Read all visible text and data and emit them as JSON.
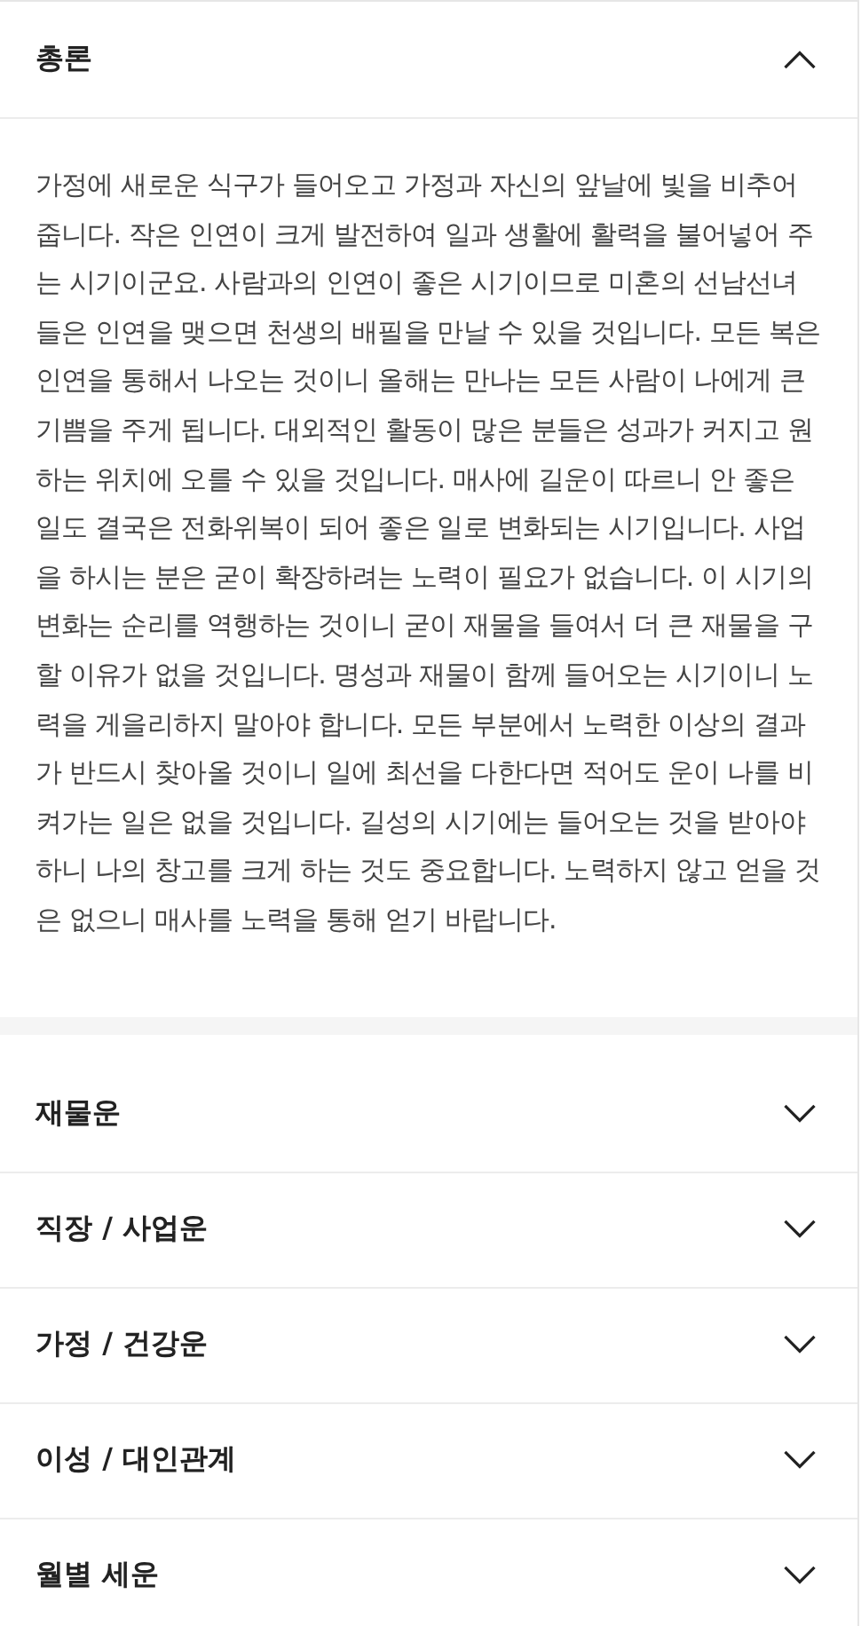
{
  "sections": [
    {
      "title": "총론",
      "expanded": true,
      "body": "가정에 새로운 식구가 들어오고 가정과 자신의 앞날에 빛을 비추어 줍니다. 작은 인연이 크게 발전하여 일과 생활에 활력을 불어넣어 주는 시기이군요. 사람과의 인연이 좋은 시기이므로 미혼의 선남선녀 들은 인연을 맺으면 천생의 배필을 만날 수 있을 것입니다. 모든 복은 인연을 통해서 나오는 것이니 올해는 만나는 모든 사람이 나에게 큰 기쁨을 주게 됩니다. 대외적인 활동이 많은 분들은 성과가 커지고 원하는 위치에 오를 수 있을 것입니다. 매사에 길운이 따르니 안 좋은 일도 결국은 전화위복이 되어 좋은 일로 변화되는 시기입니다. 사업을 하시는 분은 굳이 확장하려는 노력이 필요가 없습니다. 이 시기의 변화는 순리를 역행하는 것이니 굳이 재물을 들여서 더 큰 재물을 구할 이유가 없을 것입니다. 명성과 재물이 함께 들어오는 시기이니 노력을 게을리하지 말아야 합니다. 모든 부분에서 노력한 이상의 결과가 반드시 찾아올 것이니 일에 최선을 다한다면 적어도 운이 나를 비켜가는 일은 없을 것입니다. 길성의 시기에는 들어오는 것을 받아야 하니 나의 창고를 크게 하는 것도 중요합니다. 노력하지 않고 얻을 것은 없으니 매사를 노력을 통해 얻기 바랍니다."
    },
    {
      "title": "재물운",
      "expanded": false
    },
    {
      "title": "직장 / 사업운",
      "expanded": false
    },
    {
      "title": "가정 / 건강운",
      "expanded": false
    },
    {
      "title": "이성 / 대인관계",
      "expanded": false
    },
    {
      "title": "월별 세운",
      "expanded": false
    }
  ]
}
